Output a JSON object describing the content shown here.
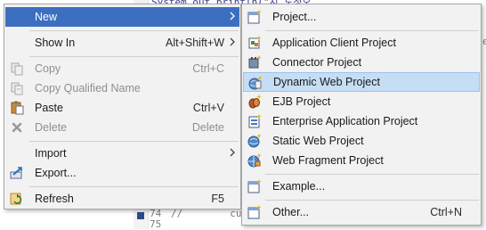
{
  "editor": {
    "top_code": "System.out.println(\"시 도정오",
    "bottom_lines": [
      {
        "num": "74",
        "code": "//        cur"
      },
      {
        "num": "75",
        "code": ""
      }
    ],
    "right_fragment": "e"
  },
  "context_menu": {
    "items": [
      {
        "label": "New",
        "shortcut": "",
        "submenu": true,
        "icon": "none",
        "highlight": "dark"
      },
      {
        "label": "Show In",
        "shortcut": "Alt+Shift+W",
        "submenu": true,
        "icon": "none"
      },
      {
        "label": "Copy",
        "shortcut": "Ctrl+C",
        "disabled": true,
        "icon": "copy-icon"
      },
      {
        "label": "Copy Qualified Name",
        "shortcut": "",
        "disabled": true,
        "icon": "copy-qualified-name-icon"
      },
      {
        "label": "Paste",
        "shortcut": "Ctrl+V",
        "icon": "paste-icon"
      },
      {
        "label": "Delete",
        "shortcut": "Delete",
        "disabled": true,
        "icon": "delete-icon"
      },
      {
        "label": "Import",
        "shortcut": "",
        "submenu": true,
        "icon": "none"
      },
      {
        "label": "Export...",
        "shortcut": "",
        "icon": "export-icon"
      },
      {
        "label": "Refresh",
        "shortcut": "F5",
        "icon": "refresh-icon"
      }
    ]
  },
  "new_submenu": {
    "items": [
      {
        "label": "Project...",
        "icon": "new-project-icon"
      },
      {
        "label": "Application Client Project",
        "icon": "application-client-project-icon"
      },
      {
        "label": "Connector Project",
        "icon": "connector-project-icon"
      },
      {
        "label": "Dynamic Web Project",
        "icon": "dynamic-web-project-icon",
        "highlight": "light"
      },
      {
        "label": "EJB Project",
        "icon": "ejb-project-icon"
      },
      {
        "label": "Enterprise Application Project",
        "icon": "enterprise-application-project-icon"
      },
      {
        "label": "Static Web Project",
        "icon": "static-web-project-icon"
      },
      {
        "label": "Web Fragment Project",
        "icon": "web-fragment-project-icon"
      },
      {
        "label": "Example...",
        "icon": "example-icon"
      },
      {
        "label": "Other...",
        "shortcut": "Ctrl+N",
        "icon": "other-wizard-icon"
      }
    ]
  },
  "colors": {
    "menu_bg": "#f2f2f2",
    "hover_highlight": "#c6def5",
    "disabled_text": "#8f8f8f"
  }
}
